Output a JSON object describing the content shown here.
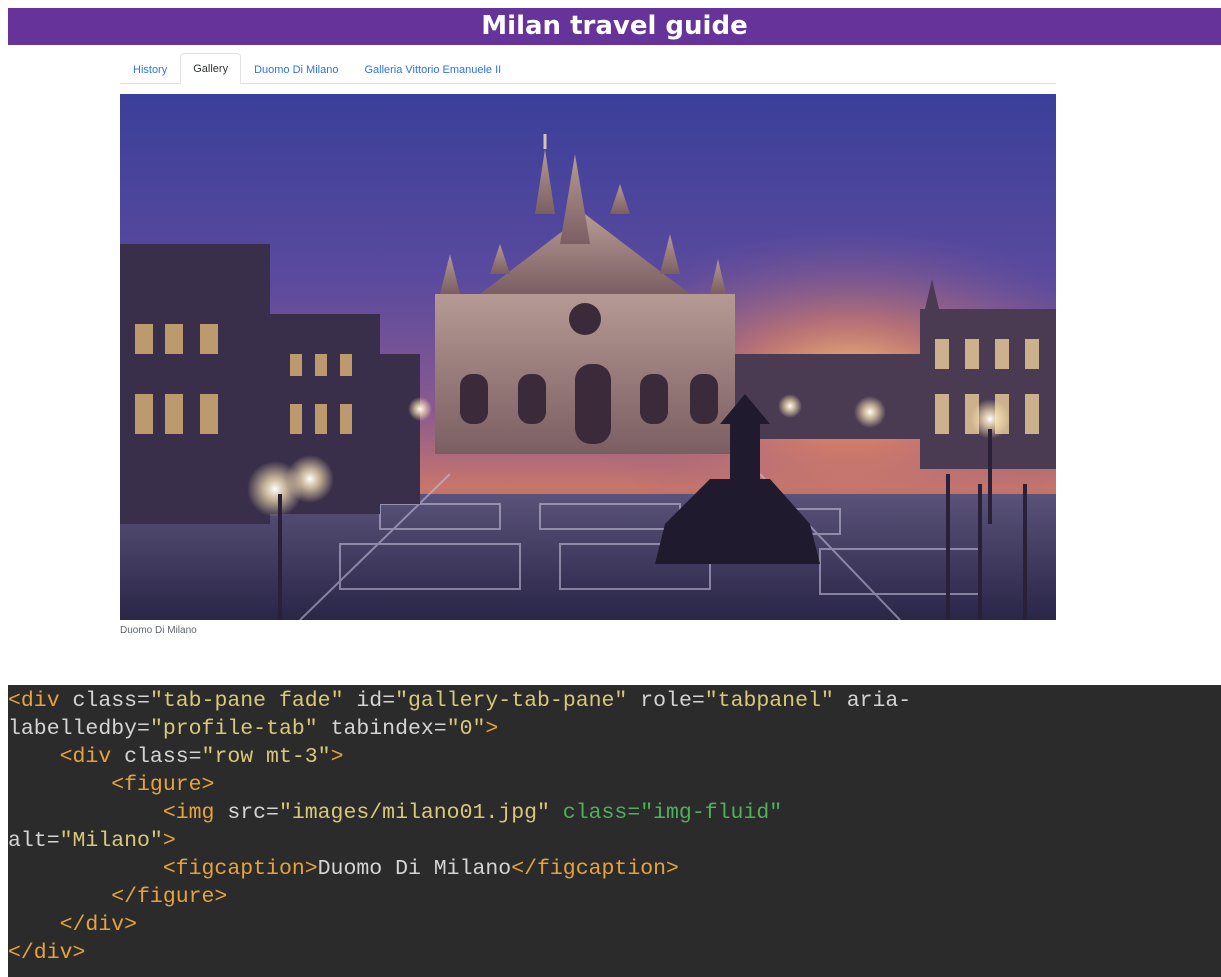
{
  "header": {
    "title": "Milan travel guide"
  },
  "tabs": [
    {
      "label": "History",
      "active": false
    },
    {
      "label": "Gallery",
      "active": true
    },
    {
      "label": "Duomo Di Milano",
      "active": false
    },
    {
      "label": "Galleria Vittorio Emanuele II",
      "active": false
    }
  ],
  "gallery": {
    "caption": "Duomo Di Milano"
  },
  "code": {
    "l1_tag_open": "<div",
    "l1_attr_class": " class=",
    "l1_val_class": "\"tab-pane fade\"",
    "l1_attr_id": " id=",
    "l1_val_id": "\"gallery-tab-pane\"",
    "l1_attr_role": " role=",
    "l1_val_role": "\"tabpanel\"",
    "l1_attr_aria": " aria-",
    "l2_attr_aria": "labelledby=",
    "l2_val_aria": "\"profile-tab\"",
    "l2_attr_tabindex": " tabindex=",
    "l2_val_tabindex": "\"0\"",
    "l2_tag_close": ">",
    "l3_tag_open": "<div",
    "l3_attr_class": " class=",
    "l3_val_class": "\"row mt-3\"",
    "l3_tag_close": ">",
    "l4_tag": "<figure>",
    "l5_tag_open": "<img",
    "l5_attr_src": " src=",
    "l5_val_src": "\"images/milano01.jpg\"",
    "l5_hl_class": " class=\"img-fluid\"",
    "l6_attr_alt": "alt=",
    "l6_val_alt": "\"Milano\"",
    "l6_tag_close": ">",
    "l7_tag_open": "<figcaption>",
    "l7_text": "Duomo Di Milano",
    "l7_tag_close": "</figcaption>",
    "l8_tag": "</figure>",
    "l9_tag": "</div>",
    "l10_tag": "</div>"
  },
  "colors": {
    "header_bg": "#66339a",
    "tab_link": "#2f73e2",
    "code_bg": "#2b2b2b",
    "code_tag": "#e6a33c",
    "code_value": "#d9c87a"
  }
}
